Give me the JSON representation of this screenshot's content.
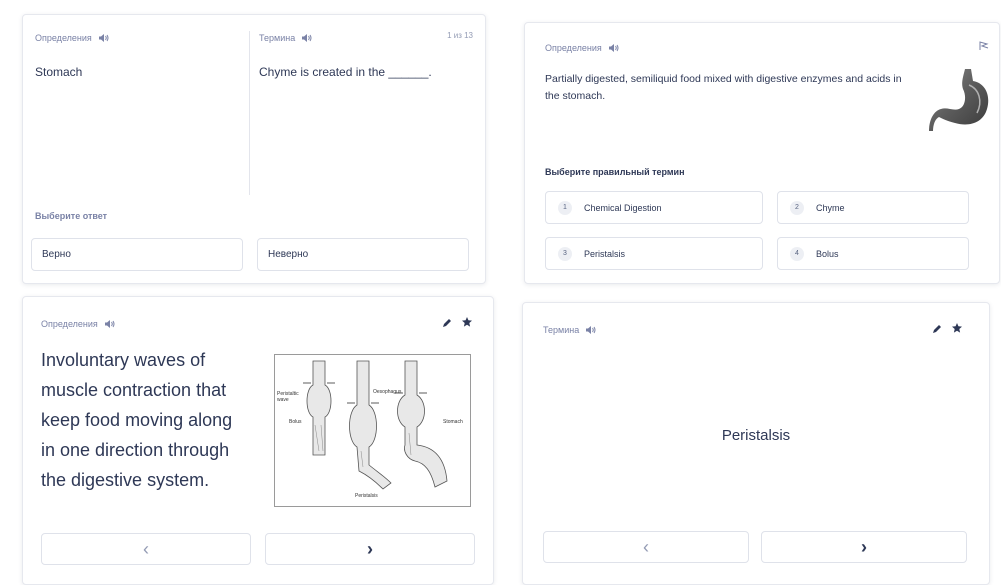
{
  "card1": {
    "definitions_label": "Определения",
    "term_label": "Термина",
    "counter": "1 из 13",
    "left_text": "Stomach",
    "right_text": "Chyme is created in the ______.",
    "prompt": "Выберите ответ",
    "true_label": "Верно",
    "false_label": "Неверно"
  },
  "card2": {
    "definitions_label": "Определения",
    "definition_text": "Partially digested, semiliquid food mixed with digestive enzymes and acids in the stomach.",
    "prompt": "Выберите правильный термин",
    "options": [
      {
        "num": "1",
        "label": "Chemical Digestion"
      },
      {
        "num": "2",
        "label": "Chyme"
      },
      {
        "num": "3",
        "label": "Peristalsis"
      },
      {
        "num": "4",
        "label": "Bolus"
      }
    ]
  },
  "card3": {
    "definitions_label": "Определения",
    "definition_text": "Involuntary waves of muscle contraction that keep food moving along in one direction through the digestive system.",
    "figure": {
      "label_wave": "Peristaltic wave",
      "label_bolus": "Bolus",
      "label_oesophagus": "Oesophagus",
      "label_stomach": "Stomach",
      "caption": "Peristalsis"
    },
    "prev_glyph": "‹",
    "next_glyph": "›"
  },
  "card4": {
    "term_label": "Термина",
    "term_text": "Peristalsis",
    "prev_glyph": "‹",
    "next_glyph": "›"
  }
}
